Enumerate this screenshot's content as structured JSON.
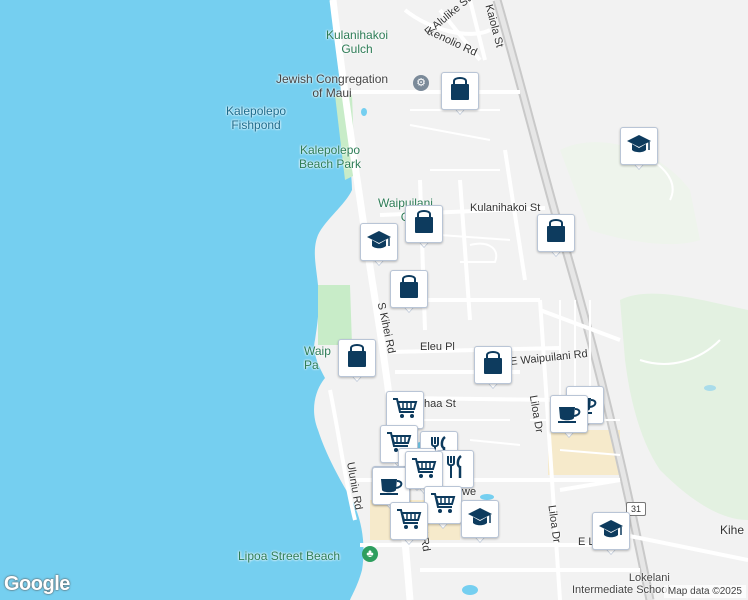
{
  "map": {
    "colors": {
      "water": "#75cff0",
      "land": "#f2f2f2",
      "road": "#ffffff",
      "highway": "#c9c9c9",
      "park": "#c8ecc8",
      "school": "#f6eacb",
      "marker_icon": "#0d3b5e"
    },
    "attribution": "Map data ©2025",
    "logo": "Google",
    "highway_shield": "31"
  },
  "road_labels": [
    {
      "text": "E Alulike St"
    },
    {
      "text": "Kaiola St"
    },
    {
      "text": "Kenolio Rd"
    },
    {
      "text": "Kulanihakoi St"
    },
    {
      "text": "S Kihei Rd"
    },
    {
      "text": "Eleu Pl"
    },
    {
      "text": "E Waipuilani Rd"
    },
    {
      "text": "haa St"
    },
    {
      "text": "Liloa Dr"
    },
    {
      "text": "Liloa Dr"
    },
    {
      "text": "Uluniu Rd"
    },
    {
      "text": "kei Rd"
    },
    {
      "text": "we"
    },
    {
      "text": "E L"
    },
    {
      "text": "Kihe"
    }
  ],
  "place_labels": [
    {
      "text": "Kulanihakoi\nGulch"
    },
    {
      "text": "Jewish Congregation\nof Maui"
    },
    {
      "text": "Kalepolepo\nFishpond"
    },
    {
      "text": "Kalepolepo\nBeach Park"
    },
    {
      "text": "Waipuilani\nG"
    },
    {
      "text": "Waip\nPa"
    },
    {
      "text": "Lipoa Street Beach"
    },
    {
      "text": "Lokelani\nIntermediate School"
    }
  ],
  "markers": [
    {
      "icon": "shopping-bag-icon"
    },
    {
      "icon": "school-icon"
    },
    {
      "icon": "shopping-bag-icon"
    },
    {
      "icon": "school-icon"
    },
    {
      "icon": "shopping-bag-icon"
    },
    {
      "icon": "shopping-bag-icon"
    },
    {
      "icon": "shopping-bag-icon"
    },
    {
      "icon": "shopping-bag-icon"
    },
    {
      "icon": "cafe-icon"
    },
    {
      "icon": "cafe-icon"
    },
    {
      "icon": "grocery-cart-icon"
    },
    {
      "icon": "grocery-cart-icon"
    },
    {
      "icon": "restaurant-icon"
    },
    {
      "icon": "restaurant-icon"
    },
    {
      "icon": "restaurant-icon"
    },
    {
      "icon": "restaurant-icon"
    },
    {
      "icon": "cafe-icon"
    },
    {
      "icon": "grocery-cart-icon"
    },
    {
      "icon": "grocery-cart-icon"
    },
    {
      "icon": "grocery-cart-icon"
    },
    {
      "icon": "school-icon"
    },
    {
      "icon": "school-icon"
    }
  ]
}
